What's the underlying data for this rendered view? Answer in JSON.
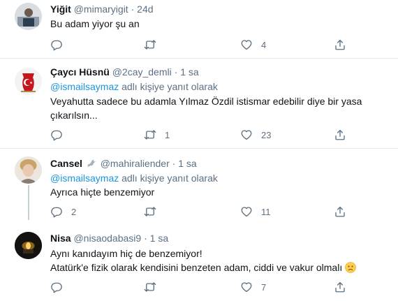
{
  "tweets": [
    {
      "name": "Yiğit",
      "handle": "@mimaryigit",
      "dot": "·",
      "time": "24d",
      "reply_mention": "",
      "reply_suffix": "",
      "text_lines": [
        "Bu adam yiyor şu an"
      ],
      "counts": {
        "reply": "",
        "retweet": "",
        "like": "4"
      }
    },
    {
      "name": "Çaycı Hüsnü",
      "handle": "@2cay_demli",
      "dot": "·",
      "time": "1 sa",
      "reply_mention": "@ismailsaymaz",
      "reply_suffix": "adlı kişiye yanıt olarak",
      "text_lines": [
        "Veyahutta sadece bu adamla Yılmaz Özdil istismar edebilir diye bir yasa",
        "çıkarılsın..."
      ],
      "counts": {
        "reply": "",
        "retweet": "1",
        "like": "23"
      }
    },
    {
      "name": "Cansel",
      "handle": "@mahiraliender",
      "dot": "·",
      "time": "1 sa",
      "reply_mention": "@ismailsaymaz",
      "reply_suffix": "adlı kişiye yanıt olarak",
      "text_lines": [
        "Ayrıca hiçte benzemiyor"
      ],
      "counts": {
        "reply": "2",
        "retweet": "",
        "like": "11"
      }
    },
    {
      "name": "Nisa",
      "handle": "@nisaodabasi9",
      "dot": "·",
      "time": "1 sa",
      "reply_mention": "",
      "reply_suffix": "",
      "text_lines": [
        "Aynı kanıdayım hiç de benzemiyor!",
        "Atatürk'e fizik olarak kendisini benzeten adam, ciddi ve vakur olmalı"
      ],
      "counts": {
        "reply": "",
        "retweet": "",
        "like": "7"
      }
    }
  ],
  "icons": {
    "reply": "reply-icon",
    "retweet": "retweet-icon",
    "like": "heart-icon",
    "share": "share-icon",
    "dove": "dove-icon",
    "sad": "sad-face-emoji"
  },
  "colors": {
    "accent": "#1b95e0",
    "muted": "#5b7083",
    "text": "#0f1419",
    "divider": "#e6ecf0"
  }
}
